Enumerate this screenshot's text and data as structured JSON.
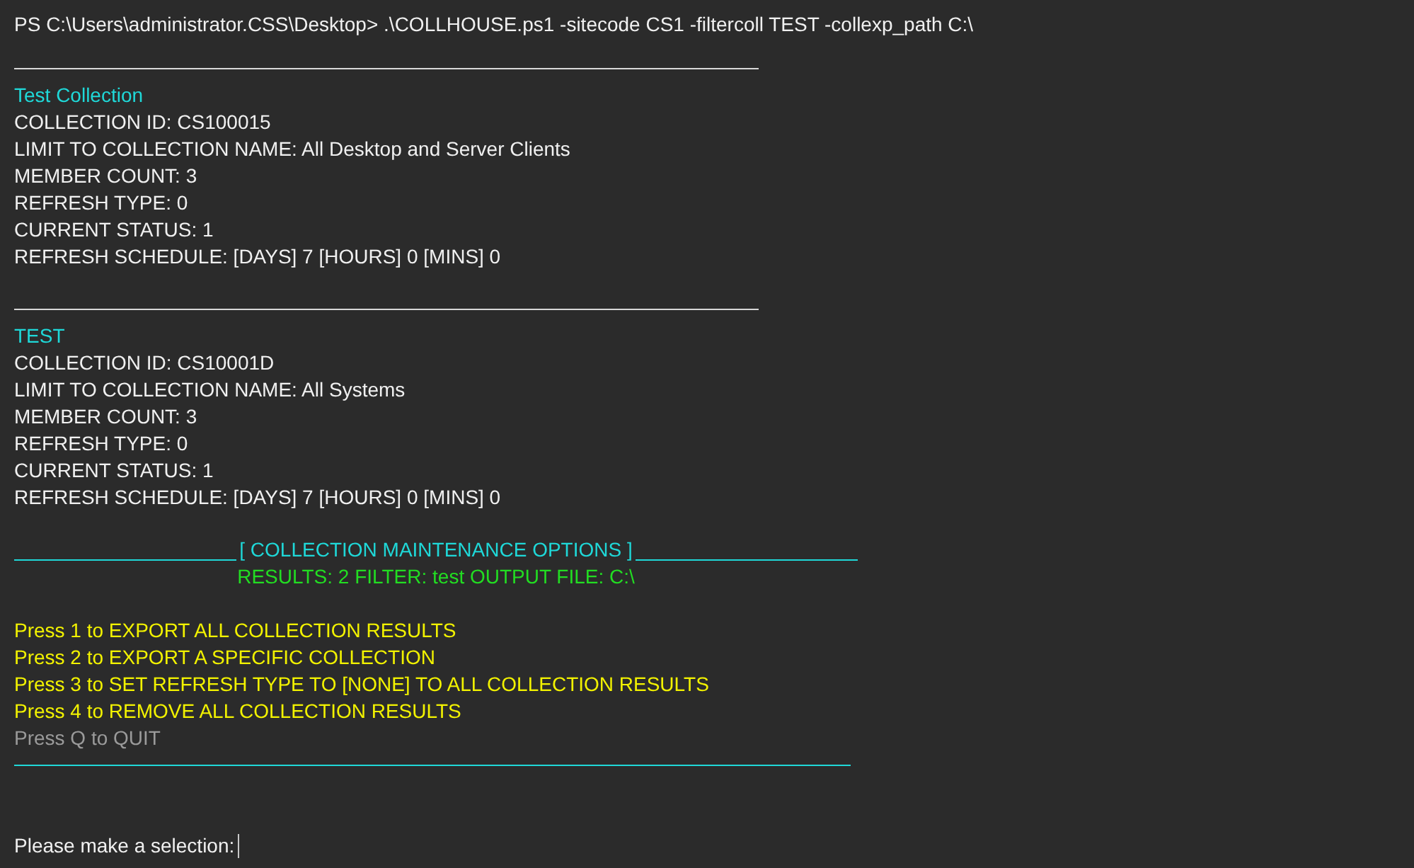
{
  "command": "PS C:\\Users\\administrator.CSS\\Desktop> .\\COLLHOUSE.ps1 -sitecode CS1 -filtercoll TEST -collexp_path C:\\",
  "collections": [
    {
      "name": "Test Collection",
      "fields": [
        "COLLECTION ID: CS100015",
        "LIMIT TO COLLECTION NAME: All Desktop and Server Clients",
        "MEMBER COUNT: 3",
        "REFRESH TYPE: 0",
        "CURRENT STATUS: 1",
        "REFRESH SCHEDULE: [DAYS] 7 [HOURS] 0 [MINS] 0"
      ]
    },
    {
      "name": "TEST",
      "fields": [
        "COLLECTION ID: CS10001D",
        "LIMIT TO COLLECTION NAME: All Systems",
        "MEMBER COUNT: 3",
        "REFRESH TYPE: 0",
        "CURRENT STATUS: 1",
        "REFRESH SCHEDULE: [DAYS] 7 [HOURS] 0 [MINS] 0"
      ]
    }
  ],
  "menu": {
    "title": "[ COLLECTION MAINTENANCE OPTIONS ]",
    "summary": "RESULTS: 2 FILTER: test OUTPUT FILE: C:\\",
    "options": [
      {
        "text": "Press 1 to EXPORT ALL COLLECTION RESULTS",
        "kind": "action"
      },
      {
        "text": "Press 2 to EXPORT A SPECIFIC COLLECTION",
        "kind": "action"
      },
      {
        "text": "Press 3 to SET REFRESH TYPE TO [NONE] TO ALL COLLECTION RESULTS",
        "kind": "action"
      },
      {
        "text": "Press 4 to REMOVE ALL COLLECTION RESULTS",
        "kind": "action"
      },
      {
        "text": "Press Q to QUIT",
        "kind": "quit"
      }
    ]
  },
  "prompt": "Please make a selection:"
}
